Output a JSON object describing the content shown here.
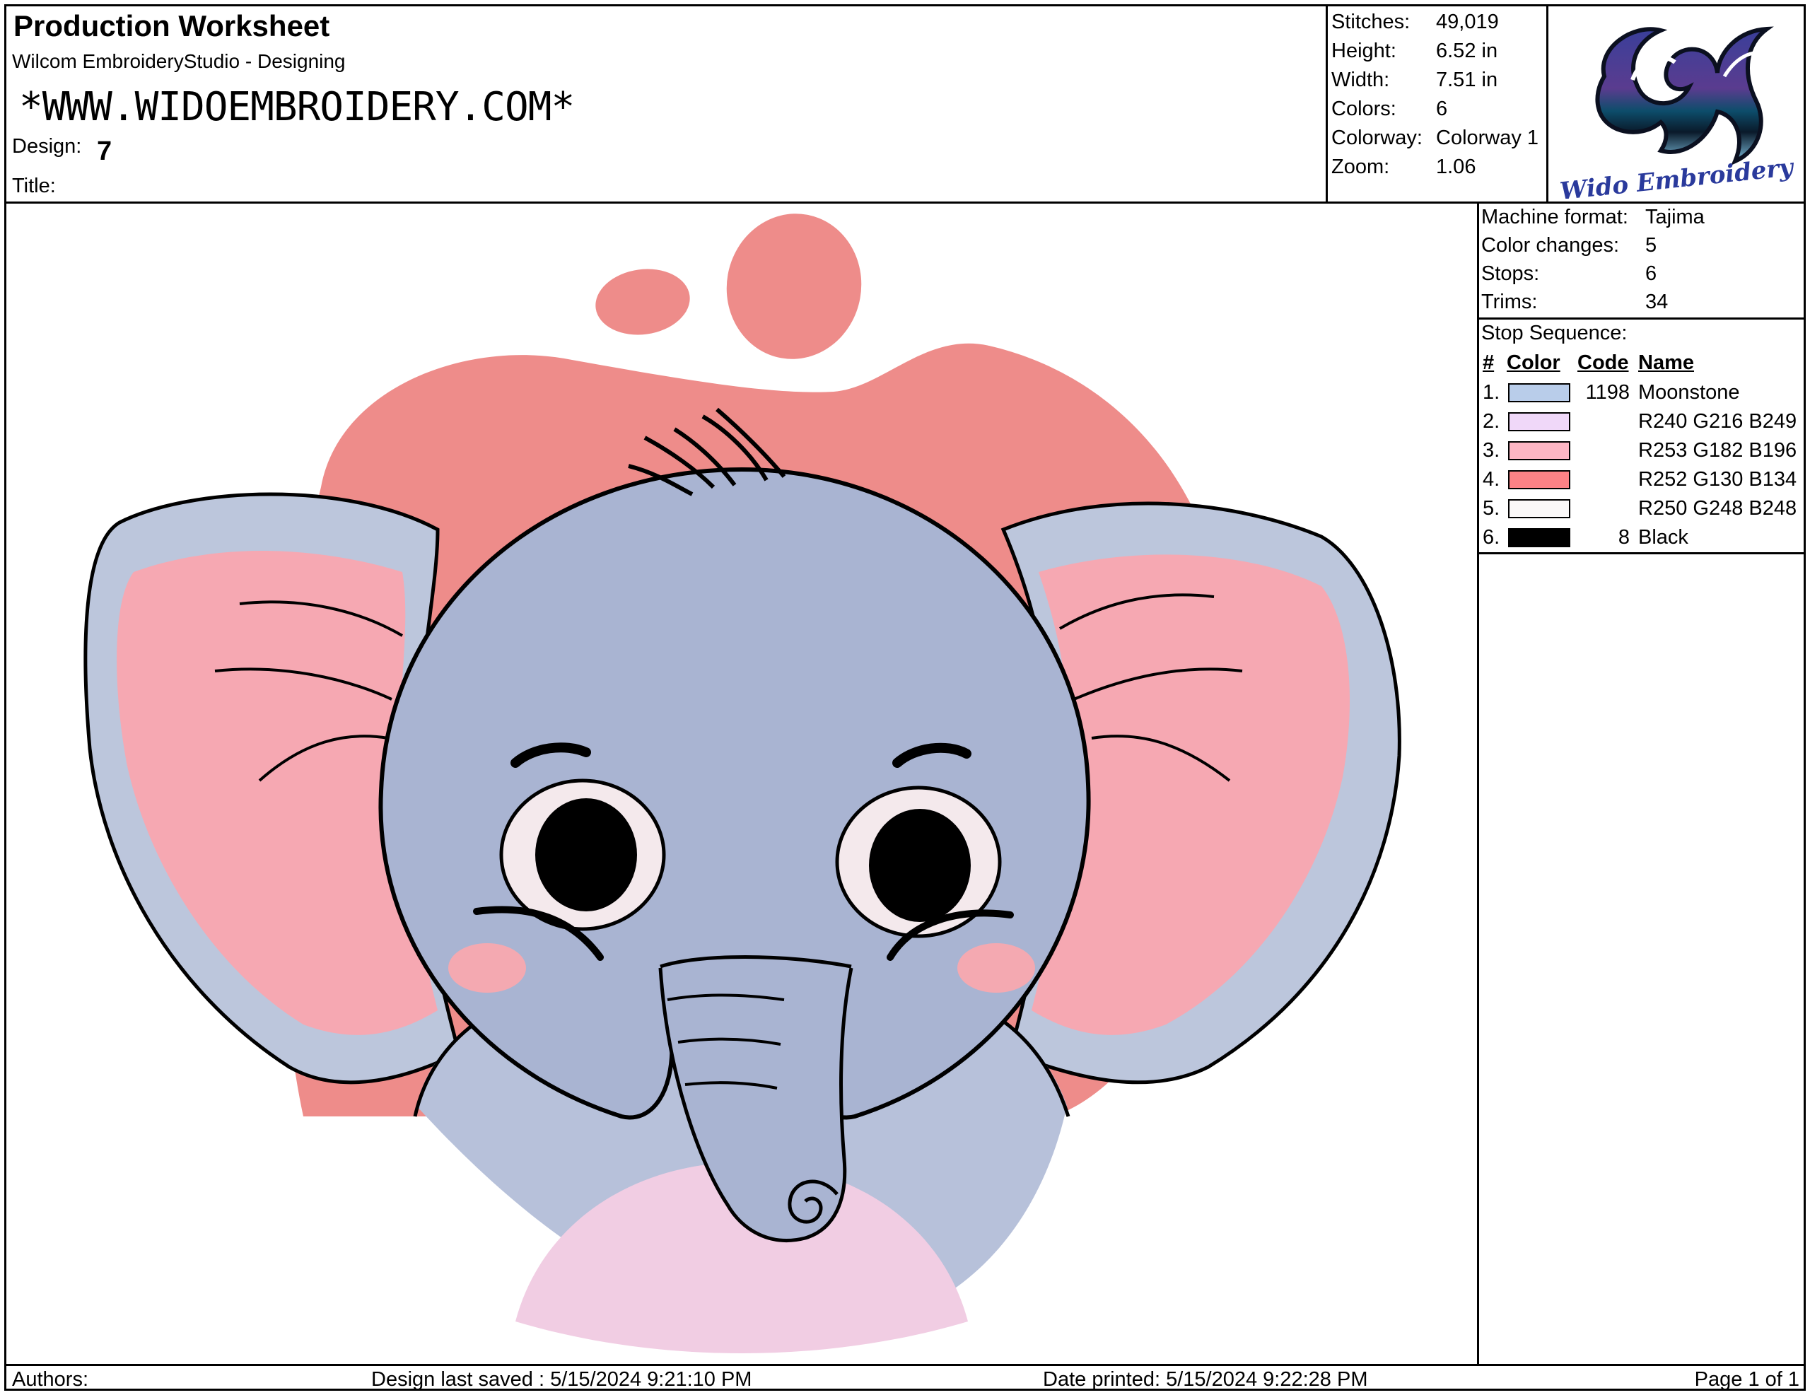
{
  "header": {
    "title": "Production Worksheet",
    "software": "Wilcom EmbroideryStudio - Designing",
    "website": "*WWW.WIDOEMBROIDERY.COM*",
    "design_label": "Design:",
    "design_value": "7",
    "title_label": "Title:",
    "title_value": ""
  },
  "stats": {
    "stitches_label": "Stitches:",
    "stitches_value": "49,019",
    "height_label": "Height:",
    "height_value": "6.52 in",
    "width_label": "Width:",
    "width_value": "7.51 in",
    "colors_label": "Colors:",
    "colors_value": "6",
    "colorway_label": "Colorway:",
    "colorway_value": "Colorway 1",
    "zoom_label": "Zoom:",
    "zoom_value": "1.06"
  },
  "logo": {
    "text": "Wido Embroidery",
    "icon": "wido-logo-icon"
  },
  "machine": {
    "format_label": "Machine format:",
    "format_value": "Tajima",
    "changes_label": "Color changes:",
    "changes_value": "5",
    "stops_label": "Stops:",
    "stops_value": "6",
    "trims_label": "Trims:",
    "trims_value": "34"
  },
  "sequence": {
    "title": "Stop Sequence:",
    "headers": {
      "num": "#",
      "color": "Color",
      "code": "Code",
      "name": "Name"
    },
    "rows": [
      {
        "num": "1.",
        "color": "#b9cdea",
        "code": "1198",
        "name": "Moonstone"
      },
      {
        "num": "2.",
        "color": "#f0d8f9",
        "code": "",
        "name": "R240 G216 B249"
      },
      {
        "num": "3.",
        "color": "#fdb6c4",
        "code": "",
        "name": "R253 G182 B196"
      },
      {
        "num": "4.",
        "color": "#fc8286",
        "code": "",
        "name": "R252 G130 B134"
      },
      {
        "num": "5.",
        "color": "#faf8f8",
        "code": "",
        "name": "R250 G248 B248"
      },
      {
        "num": "6.",
        "color": "#000000",
        "code": "8",
        "name": "Black"
      }
    ]
  },
  "design_image": {
    "subject": "elephant-embroidery",
    "colors": {
      "blob": "#ee8c8a",
      "ear_outer": "#bcc6dc",
      "ear_inner": "#f6a8b2",
      "head": "#a9b4d2",
      "body": "#b7c1da",
      "belly": "#f1cde3",
      "eye_white": "#f4e9ec",
      "cheek": "#f4a9b1",
      "outline": "#000000"
    }
  },
  "footer": {
    "authors_label": "Authors:",
    "saved": "Design last saved : 5/15/2024 9:21:10 PM",
    "printed": "Date printed: 5/15/2024 9:22:28 PM",
    "page": "Page 1 of 1"
  }
}
